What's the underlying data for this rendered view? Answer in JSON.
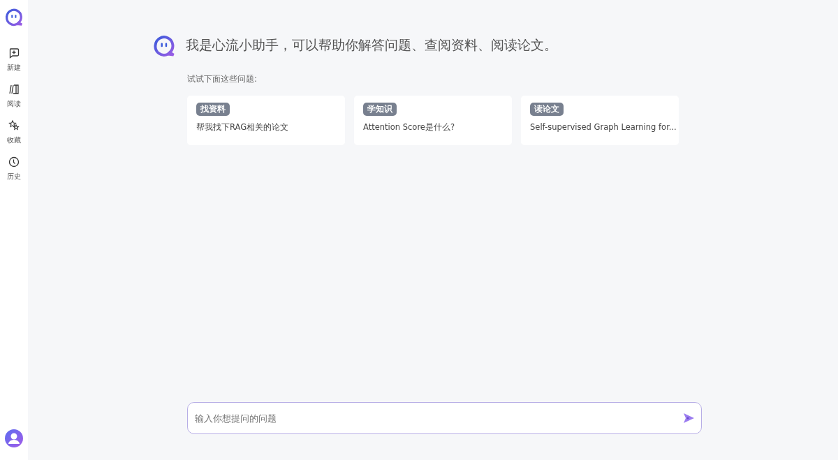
{
  "sidebar": {
    "items": [
      {
        "kind": "new",
        "label": "新建"
      },
      {
        "kind": "read",
        "label": "阅读"
      },
      {
        "kind": "star",
        "label": "收藏"
      },
      {
        "kind": "history",
        "label": "历史"
      }
    ]
  },
  "greeting": "我是心流小助手，可以帮助你解答问题、查阅资料、阅读论文。",
  "suggestions_title": "试试下面这些问题:",
  "suggestions": [
    {
      "tag": "找资料",
      "text": "帮我找下RAG相关的论文"
    },
    {
      "tag": "学知识",
      "text": "Attention Score是什么?"
    },
    {
      "tag": "读论文",
      "text": "Self-supervised Graph Learning for..."
    }
  ],
  "input": {
    "placeholder": "输入你想提问的问题"
  }
}
